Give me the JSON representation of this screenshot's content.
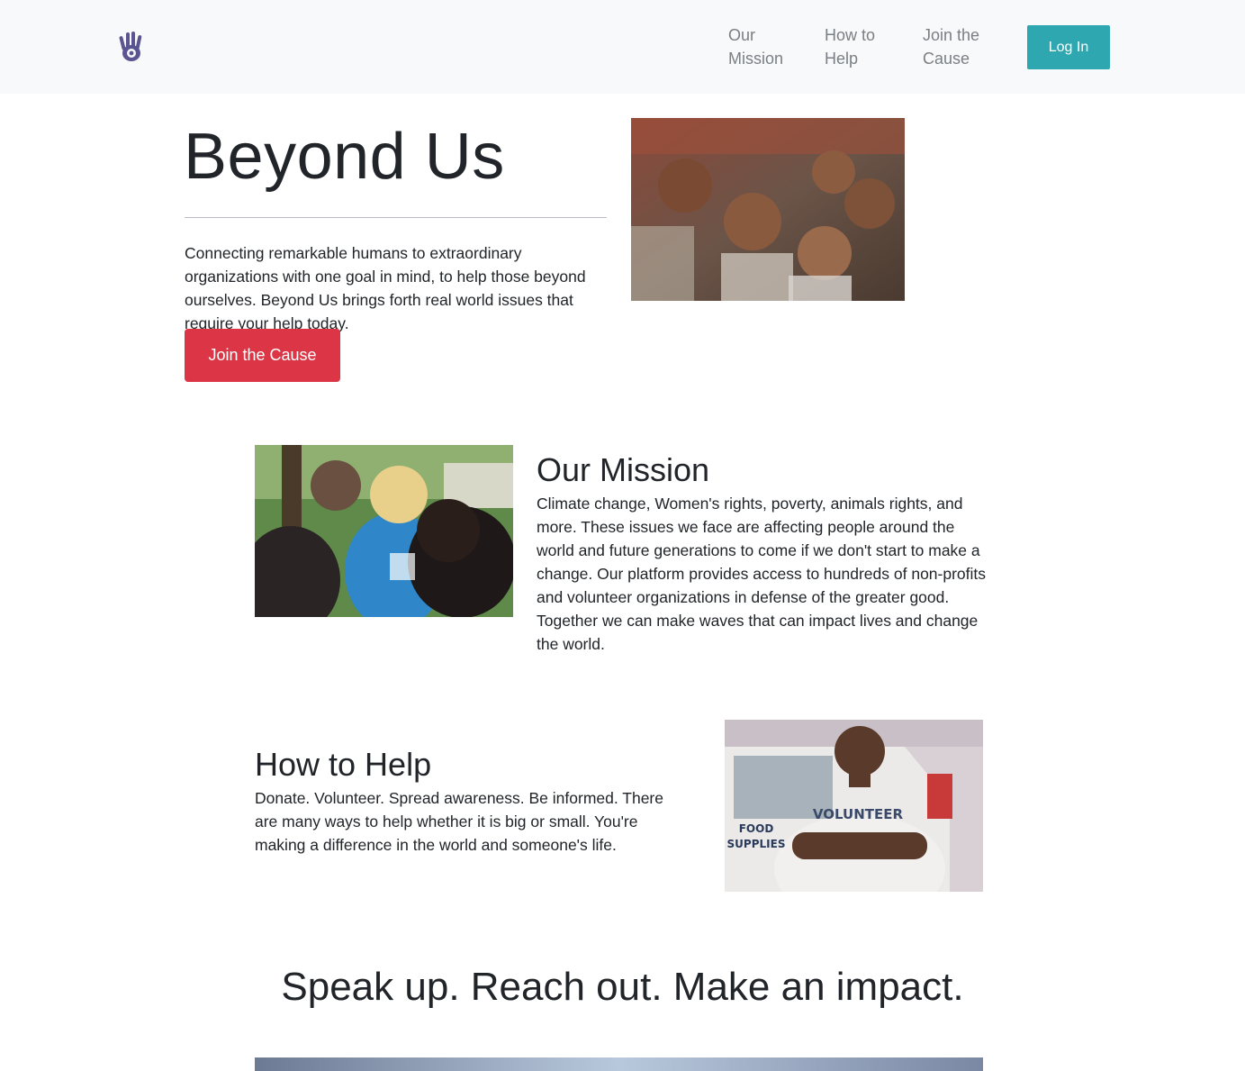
{
  "navbar": {
    "logo_icon": "hand-icon",
    "links": [
      {
        "line1": "Our",
        "line2": "Mission"
      },
      {
        "line1": "How to",
        "line2": "Help"
      },
      {
        "line1": "Join the",
        "line2": "Cause"
      }
    ],
    "login_label": "Log In"
  },
  "hero": {
    "title": "Beyond Us",
    "text": "Connecting remarkable humans to extraordinary organizations with one goal in mind, to help those beyond ourselves. Beyond Us brings forth real world issues that require your help today.",
    "cta_label": "Join the Cause"
  },
  "mission": {
    "title": "Our Mission",
    "text": "Climate change, Women's rights, poverty, animals rights, and more. These issues we face are affecting people around the world and future generations to come if we don't start to make a change. Our platform provides access to hundreds of non-profits and volunteer organizations in defense of the greater good. Together we can make waves that can impact lives and change the world."
  },
  "help": {
    "title": "How to Help",
    "text": "Donate. Volunteer. Spread awareness. Be informed. There are many ways to help whether it is big or small. You're making a difference in the world and someone's life.",
    "photo_shirt_text": "VOLUNTEER",
    "photo_sign_line1": "FOOD",
    "photo_sign_line2": "SUPPLIES"
  },
  "tagline": "Speak up. Reach out. Make an impact.",
  "colors": {
    "navbar_bg": "#f8f9fa",
    "login_button": "#2fa7b0",
    "cta_button": "#dc3545",
    "logo": "#5a5590",
    "text": "#212529"
  }
}
